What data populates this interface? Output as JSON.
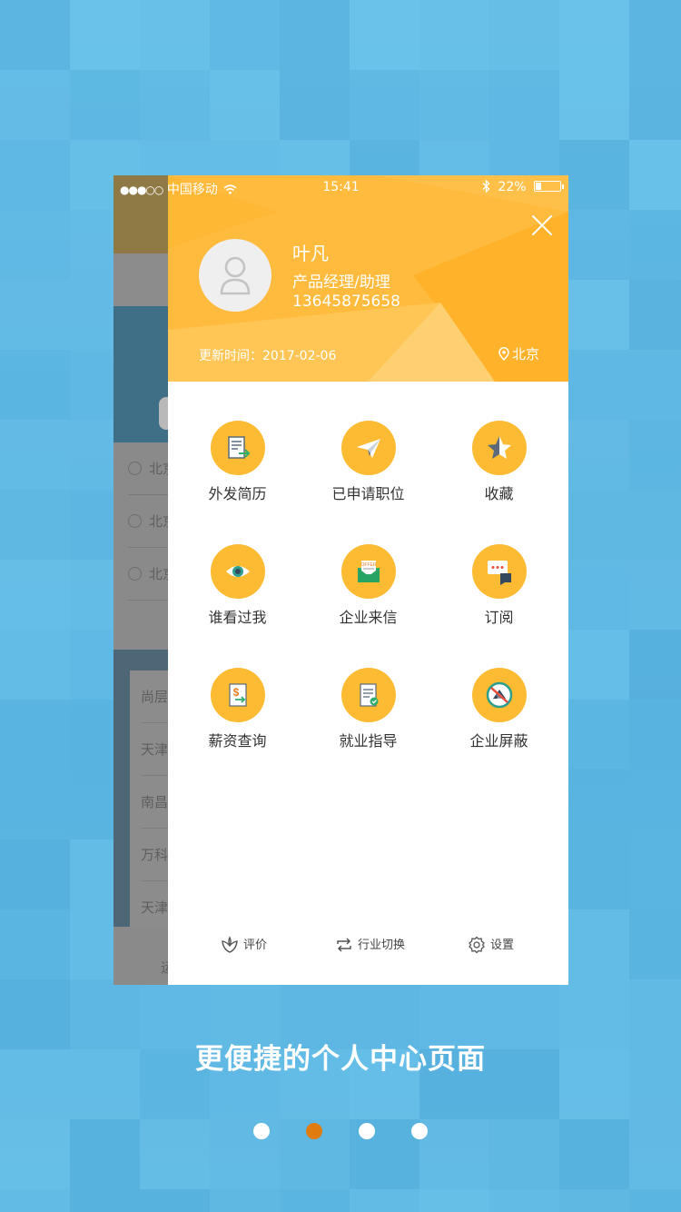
{
  "status_bar": {
    "signal": "●●●○○",
    "carrier": "中国移动",
    "time": "15:41",
    "battery": "22%",
    "battery_level": 0.22
  },
  "behind": {
    "rows": [
      "北京",
      "北京",
      "北京"
    ],
    "card_rows": [
      "尚层",
      "天津",
      "南昌",
      "万科",
      "天津"
    ],
    "bottom_label": "运"
  },
  "profile": {
    "name": "叶凡",
    "title": "产品经理/助理",
    "phone": "13645875658",
    "updated": "更新时间：2017-02-06",
    "location": "北京"
  },
  "menu": [
    {
      "label": "外发简历",
      "icon": "resume-send-icon"
    },
    {
      "label": "已申请职位",
      "icon": "paper-plane-icon"
    },
    {
      "label": "收藏",
      "icon": "star-icon"
    },
    {
      "label": "谁看过我",
      "icon": "eye-icon"
    },
    {
      "label": "企业来信",
      "icon": "offer-mail-icon"
    },
    {
      "label": "订阅",
      "icon": "chat-bubble-icon"
    },
    {
      "label": "薪资查询",
      "icon": "salary-doc-icon"
    },
    {
      "label": "就业指导",
      "icon": "guide-doc-icon"
    },
    {
      "label": "企业屏蔽",
      "icon": "block-company-icon"
    }
  ],
  "footer": {
    "rate": "评价",
    "switch_industry": "行业切换",
    "settings": "设置"
  },
  "caption": "更便捷的个人中心页面",
  "pager": {
    "count": 4,
    "active": 2
  },
  "colors": {
    "accent": "#ffbb3d",
    "icon_bg": "#fcbb32",
    "background": "#5ab6e0",
    "active_dot": "#e07b10"
  }
}
